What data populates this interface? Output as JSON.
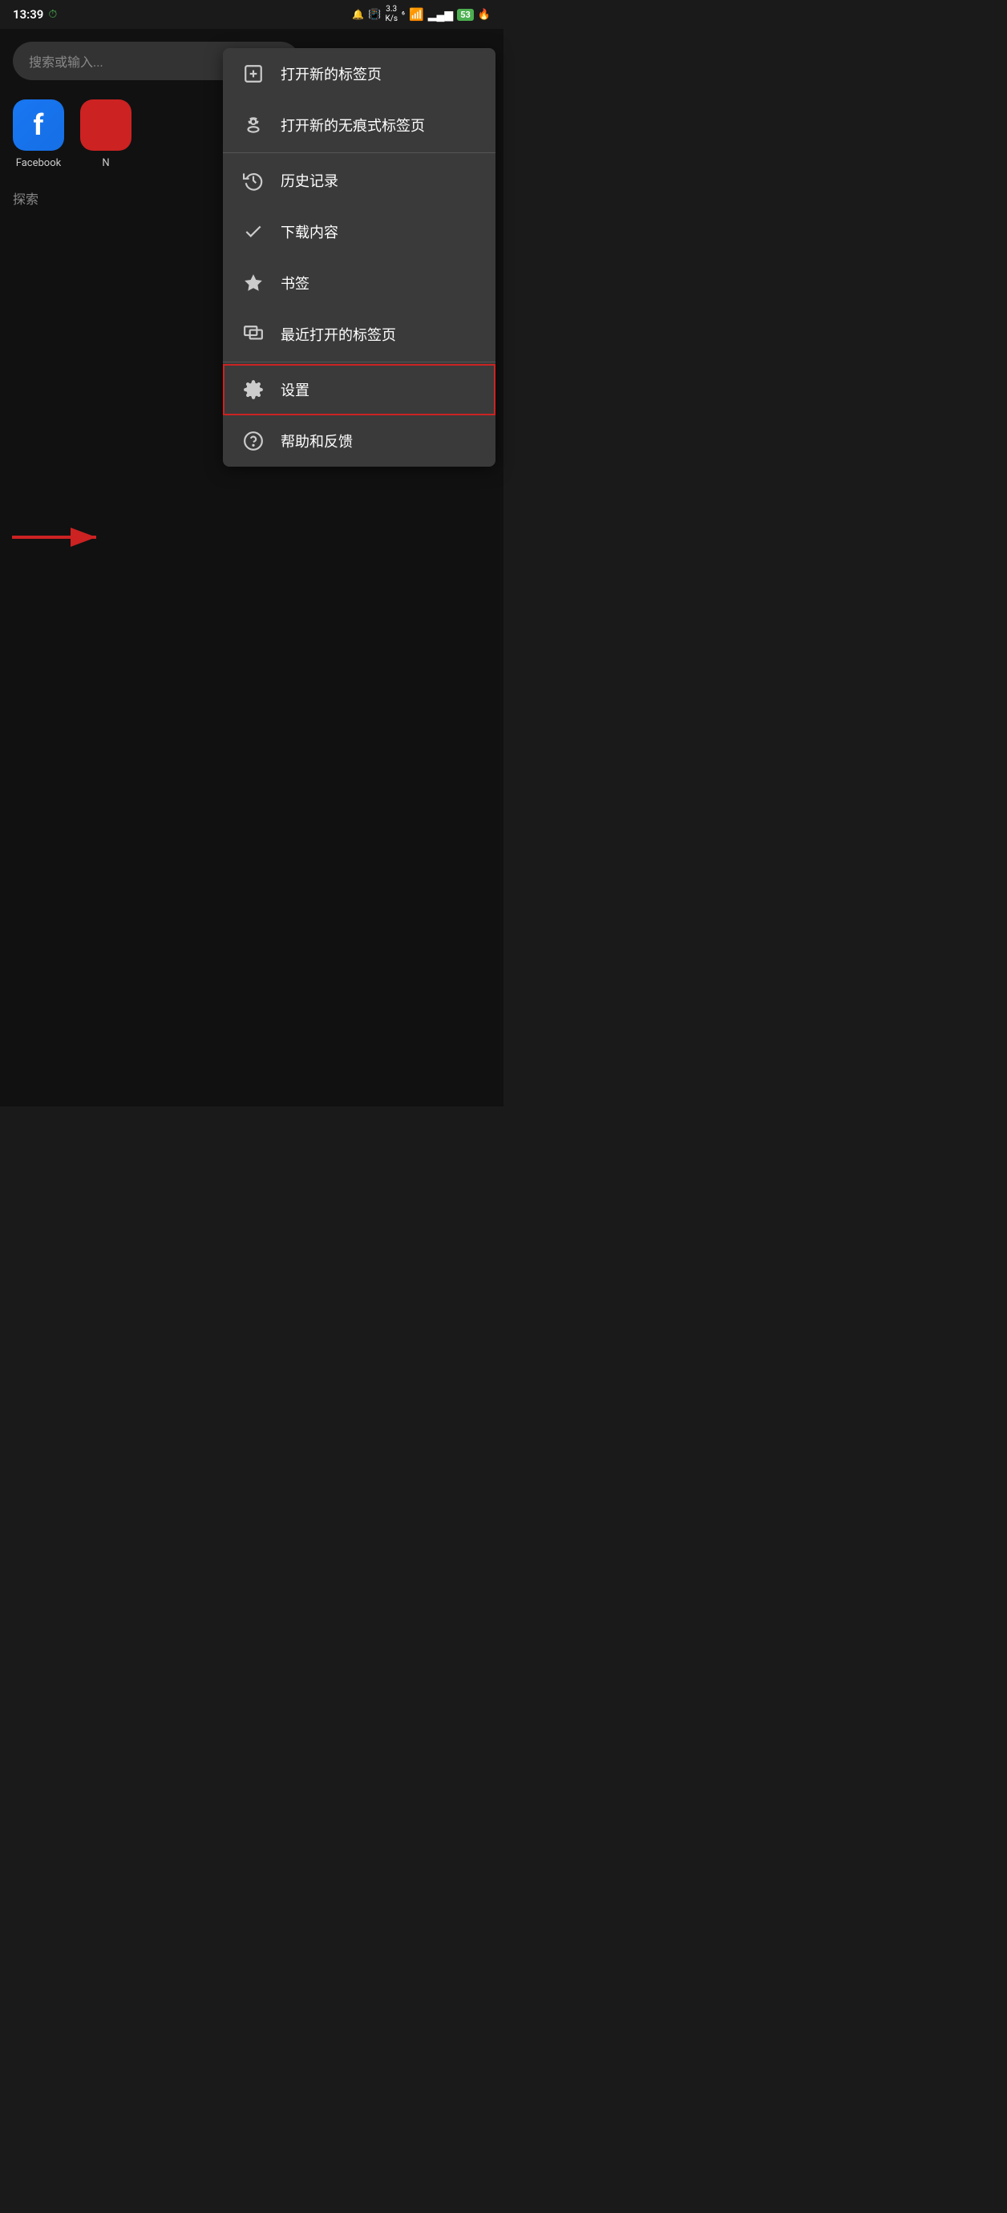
{
  "statusBar": {
    "time": "13:39",
    "timerIcon": "⏱",
    "speed": "3.3 K/s",
    "networkGen": "6",
    "battery": "53"
  },
  "background": {
    "searchPlaceholder": "搜索或输入...",
    "shortcuts": [
      {
        "label": "Facebook",
        "initial": "f"
      }
    ],
    "sectionLabel": "探索"
  },
  "menu": {
    "items": [
      {
        "id": "new-tab",
        "icon": "new-tab-icon",
        "label": "打开新的标签页",
        "highlighted": false,
        "hasDividerAfter": false
      },
      {
        "id": "incognito",
        "icon": "incognito-icon",
        "label": "打开新的无痕式标签页",
        "highlighted": false,
        "hasDividerAfter": true
      },
      {
        "id": "history",
        "icon": "history-icon",
        "label": "历史记录",
        "highlighted": false,
        "hasDividerAfter": false
      },
      {
        "id": "downloads",
        "icon": "download-icon",
        "label": "下载内容",
        "highlighted": false,
        "hasDividerAfter": false
      },
      {
        "id": "bookmarks",
        "icon": "bookmark-icon",
        "label": "书签",
        "highlighted": false,
        "hasDividerAfter": false
      },
      {
        "id": "recent-tabs",
        "icon": "recent-tabs-icon",
        "label": "最近打开的标签页",
        "highlighted": false,
        "hasDividerAfter": true
      },
      {
        "id": "settings",
        "icon": "settings-icon",
        "label": "设置",
        "highlighted": true,
        "hasDividerAfter": false
      },
      {
        "id": "help",
        "icon": "help-icon",
        "label": "帮助和反馈",
        "highlighted": false,
        "hasDividerAfter": false
      }
    ]
  },
  "annotation": {
    "arrowColor": "#cc2222"
  }
}
